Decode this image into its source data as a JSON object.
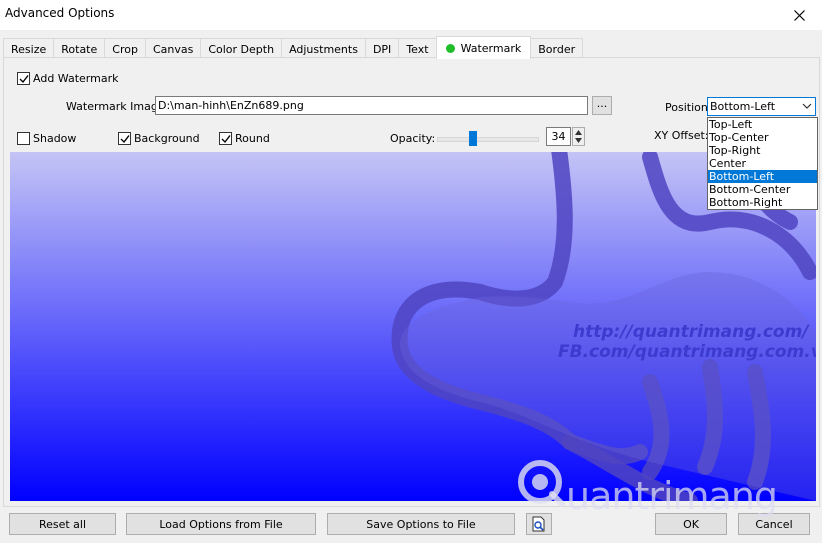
{
  "window": {
    "title": "Advanced Options"
  },
  "tabs": [
    {
      "label": "Resize"
    },
    {
      "label": "Rotate"
    },
    {
      "label": "Crop"
    },
    {
      "label": "Canvas"
    },
    {
      "label": "Color Depth"
    },
    {
      "label": "Adjustments"
    },
    {
      "label": "DPI"
    },
    {
      "label": "Text"
    },
    {
      "label": "Watermark",
      "active": true
    },
    {
      "label": "Border"
    }
  ],
  "watermark": {
    "add_label": "Add Watermark",
    "add_checked": true,
    "image_label": "Watermark Image:",
    "image_path": "D:\\man-hinh\\EnZn689.png",
    "browse_label": "...",
    "position_label": "Position:",
    "position_value": "Bottom-Left",
    "position_options": [
      "Top-Left",
      "Top-Center",
      "Top-Right",
      "Center",
      "Bottom-Left",
      "Bottom-Center",
      "Bottom-Right"
    ],
    "shadow_label": "Shadow",
    "shadow_checked": false,
    "background_label": "Background",
    "background_checked": true,
    "round_label": "Round",
    "round_checked": true,
    "opacity_label": "Opacity:",
    "opacity_value": "34",
    "xy_offset_label": "XY Offset:"
  },
  "preview": {
    "url_line1": "http://quantrimang.com/",
    "url_line2": "FB.com/quantrimang.com.vn",
    "logo_text": "uantrimang"
  },
  "buttons": {
    "reset_all": "Reset all",
    "load_options": "Load Options from File",
    "save_options": "Save Options to File",
    "ok": "OK",
    "cancel": "Cancel"
  },
  "colors": {
    "accent": "#0078d7",
    "tab_dot": "#1ebd29",
    "preview_top": "#c4c4f6",
    "preview_bottom": "#0000ff"
  }
}
